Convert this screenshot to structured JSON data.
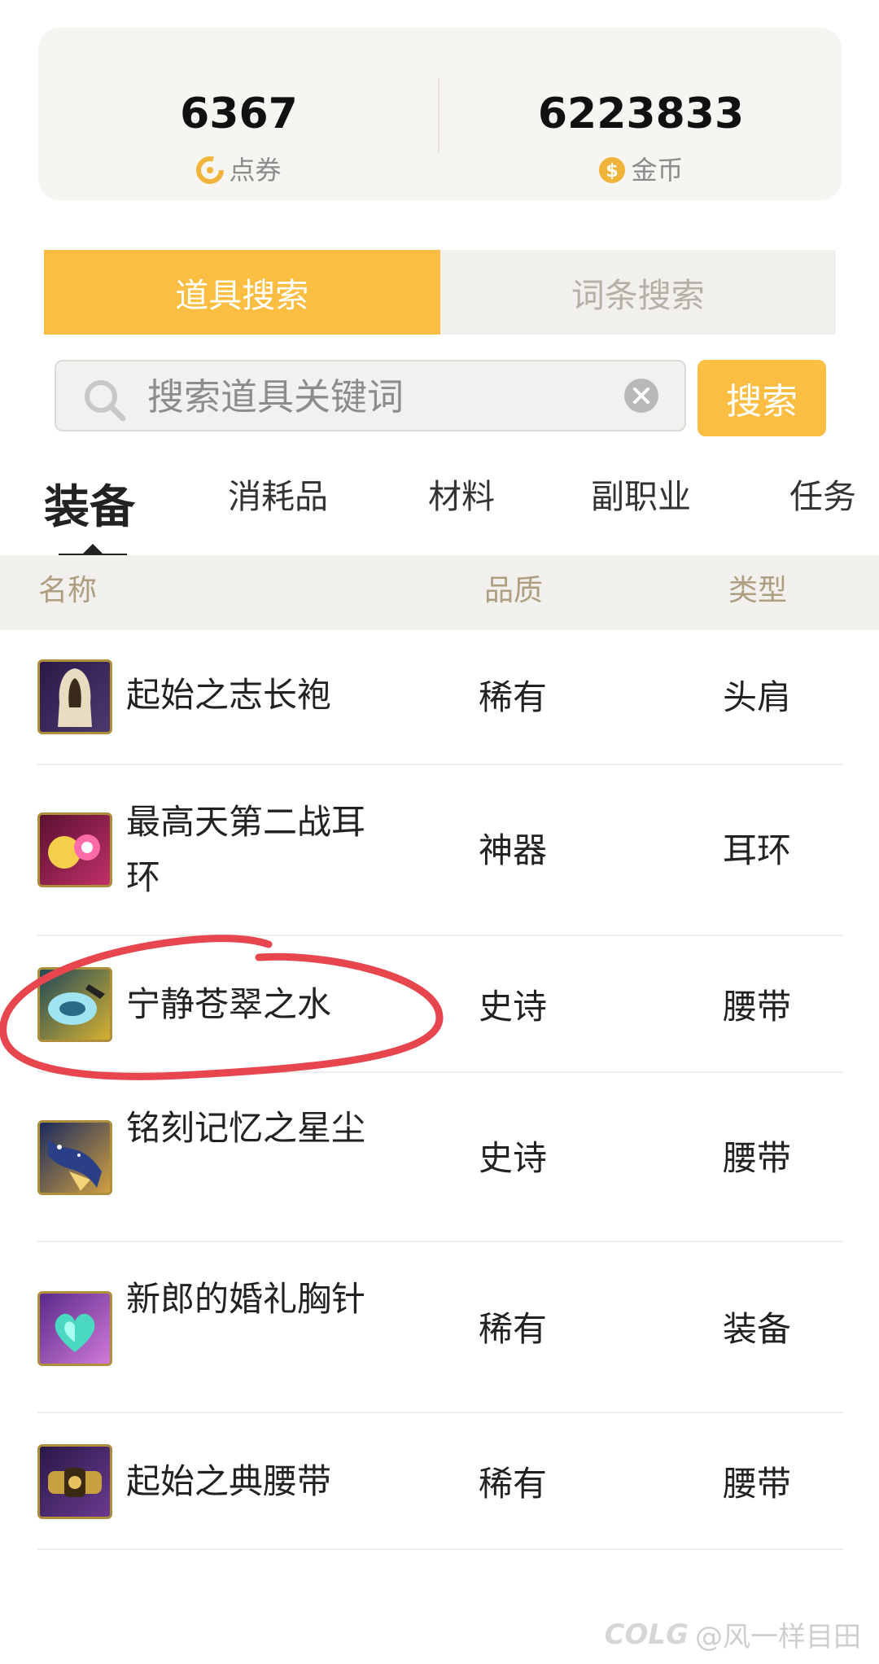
{
  "balances": {
    "points": {
      "value": "6367",
      "label": "点券",
      "icon": "points-coupon-icon"
    },
    "gold": {
      "value": "6223833",
      "label": "金币",
      "icon": "gold-coin-icon"
    }
  },
  "mode_tabs": [
    {
      "label": "道具搜索",
      "active": true
    },
    {
      "label": "词条搜索",
      "active": false
    }
  ],
  "search": {
    "placeholder": "搜索道具关键词",
    "value": "",
    "button_label": "搜索"
  },
  "categories": [
    {
      "label": "装备",
      "active": true
    },
    {
      "label": "消耗品",
      "active": false
    },
    {
      "label": "材料",
      "active": false
    },
    {
      "label": "副职业",
      "active": false
    },
    {
      "label": "任务",
      "active": false
    }
  ],
  "table": {
    "headers": {
      "name": "名称",
      "quality": "品质",
      "type": "类型"
    },
    "rows": [
      {
        "name": "起始之志长袍",
        "quality": "稀有",
        "type": "头肩",
        "icon": "robe-icon"
      },
      {
        "name": "最高天第二战耳环",
        "quality": "神器",
        "type": "耳环",
        "icon": "earring-icon"
      },
      {
        "name": "宁静苍翠之水",
        "quality": "史诗",
        "type": "腰带",
        "icon": "water-belt-icon"
      },
      {
        "name": "铭刻记忆之星尘",
        "quality": "史诗",
        "type": "腰带",
        "icon": "stardust-belt-icon"
      },
      {
        "name": "新郎的婚礼胸针",
        "quality": "稀有",
        "type": "装备",
        "icon": "heart-brooch-icon"
      },
      {
        "name": "起始之典腰带",
        "quality": "稀有",
        "type": "腰带",
        "icon": "belt-icon"
      }
    ]
  },
  "watermark": {
    "logo": "COLG",
    "user": "@风一样目田"
  },
  "colors": {
    "accent": "#fbbd42",
    "annotation": "#e8464f"
  }
}
